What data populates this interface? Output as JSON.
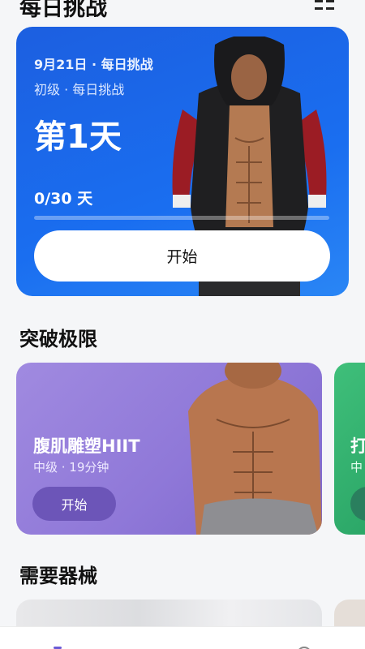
{
  "header": {
    "title": "每日挑战",
    "grid_icon": "grid-icon"
  },
  "daily_challenge": {
    "date": "9月21日 · 每日挑战",
    "level": "初级 · 每日挑战",
    "day": "第1天",
    "progress_text": "0/30 天",
    "progress": 0,
    "start_label": "开始",
    "color": "#1a6ef0"
  },
  "breakthrough": {
    "title": "突破极限",
    "cards": [
      {
        "title": "腹肌雕塑HIIT",
        "meta": "中级 · 19分钟",
        "start_label": "开始",
        "color": "#8f78d8"
      },
      {
        "title": "打",
        "meta": "中",
        "color": "#2aa566"
      }
    ]
  },
  "equipment": {
    "title": "需要器械"
  },
  "bottom_nav": {
    "left_icon": "home-icon",
    "right_icon": "profile-icon",
    "accent": "#6a5bd6"
  }
}
